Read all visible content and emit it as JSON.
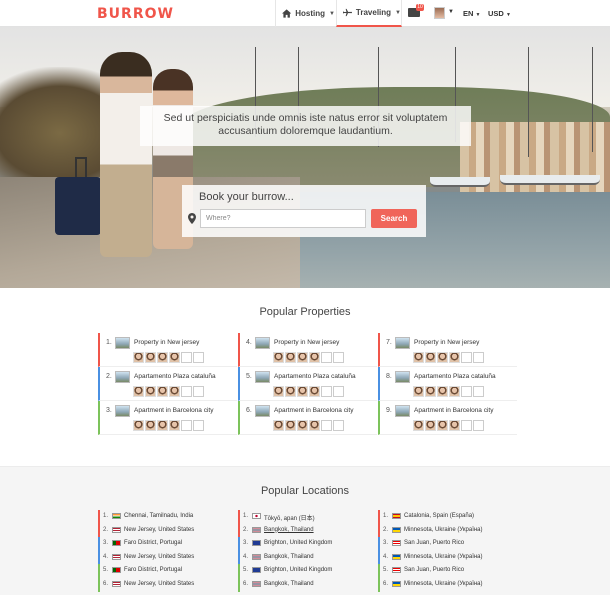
{
  "brand": {
    "logo_text": "BURROW",
    "accent": "#f0554a"
  },
  "nav": {
    "hosting": "Hosting",
    "traveling": "Traveling",
    "mail_badge": "10",
    "language": "EN",
    "currency": "USD"
  },
  "hero": {
    "tagline": "Sed ut perspiciatis unde omnis iste natus error sit voluptatem accusantium doloremque laudantium.",
    "search_title": "Book your burrow...",
    "search_placeholder": "Where?",
    "search_button": "Search"
  },
  "popular_properties": {
    "title": "Popular Properties",
    "columns": [
      [
        {
          "num": "1.",
          "name": "Property in New jersey"
        },
        {
          "num": "2.",
          "name": "Apartamento Plaza cataluña"
        },
        {
          "num": "3.",
          "name": "Apartment in Barcelona city"
        }
      ],
      [
        {
          "num": "4.",
          "name": "Property in New jersey"
        },
        {
          "num": "5.",
          "name": "Apartamento Plaza cataluña"
        },
        {
          "num": "6.",
          "name": "Apartment in Barcelona city"
        }
      ],
      [
        {
          "num": "7.",
          "name": "Property in New jersey"
        },
        {
          "num": "8.",
          "name": "Apartamento Plaza cataluña"
        },
        {
          "num": "9.",
          "name": "Apartment in Barcelona city"
        }
      ]
    ]
  },
  "popular_locations": {
    "title": "Popular Locations",
    "columns": [
      [
        {
          "num": "1.",
          "name": "Chennai, Tamilnadu, India"
        },
        {
          "num": "2.",
          "name": "New Jersey, United States"
        },
        {
          "num": "3.",
          "name": "Faro District, Portugal"
        },
        {
          "num": "4.",
          "name": "New Jersey, United States"
        },
        {
          "num": "5.",
          "name": "Faro District, Portugal"
        },
        {
          "num": "6.",
          "name": "New Jersey, United States"
        }
      ],
      [
        {
          "num": "1.",
          "name": "Tōkyō, apan (日本)"
        },
        {
          "num": "2.",
          "name": "Bangkok, Thailand"
        },
        {
          "num": "3.",
          "name": "Brighton, United Kingdom"
        },
        {
          "num": "4.",
          "name": "Bangkok, Thailand"
        },
        {
          "num": "5.",
          "name": "Brighton, United Kingdom"
        },
        {
          "num": "6.",
          "name": "Bangkok, Thailand"
        }
      ],
      [
        {
          "num": "1.",
          "name": "Catalonia, Spain (España)"
        },
        {
          "num": "2.",
          "name": "Minnesota, Ukraine (Україна)"
        },
        {
          "num": "3.",
          "name": "San Juan, Puerto Rico"
        },
        {
          "num": "4.",
          "name": "Minnesota, Ukraine (Україна)"
        },
        {
          "num": "5.",
          "name": "San Juan, Puerto Rico"
        },
        {
          "num": "6.",
          "name": "Minnesota, Ukraine (Україна)"
        }
      ]
    ]
  }
}
